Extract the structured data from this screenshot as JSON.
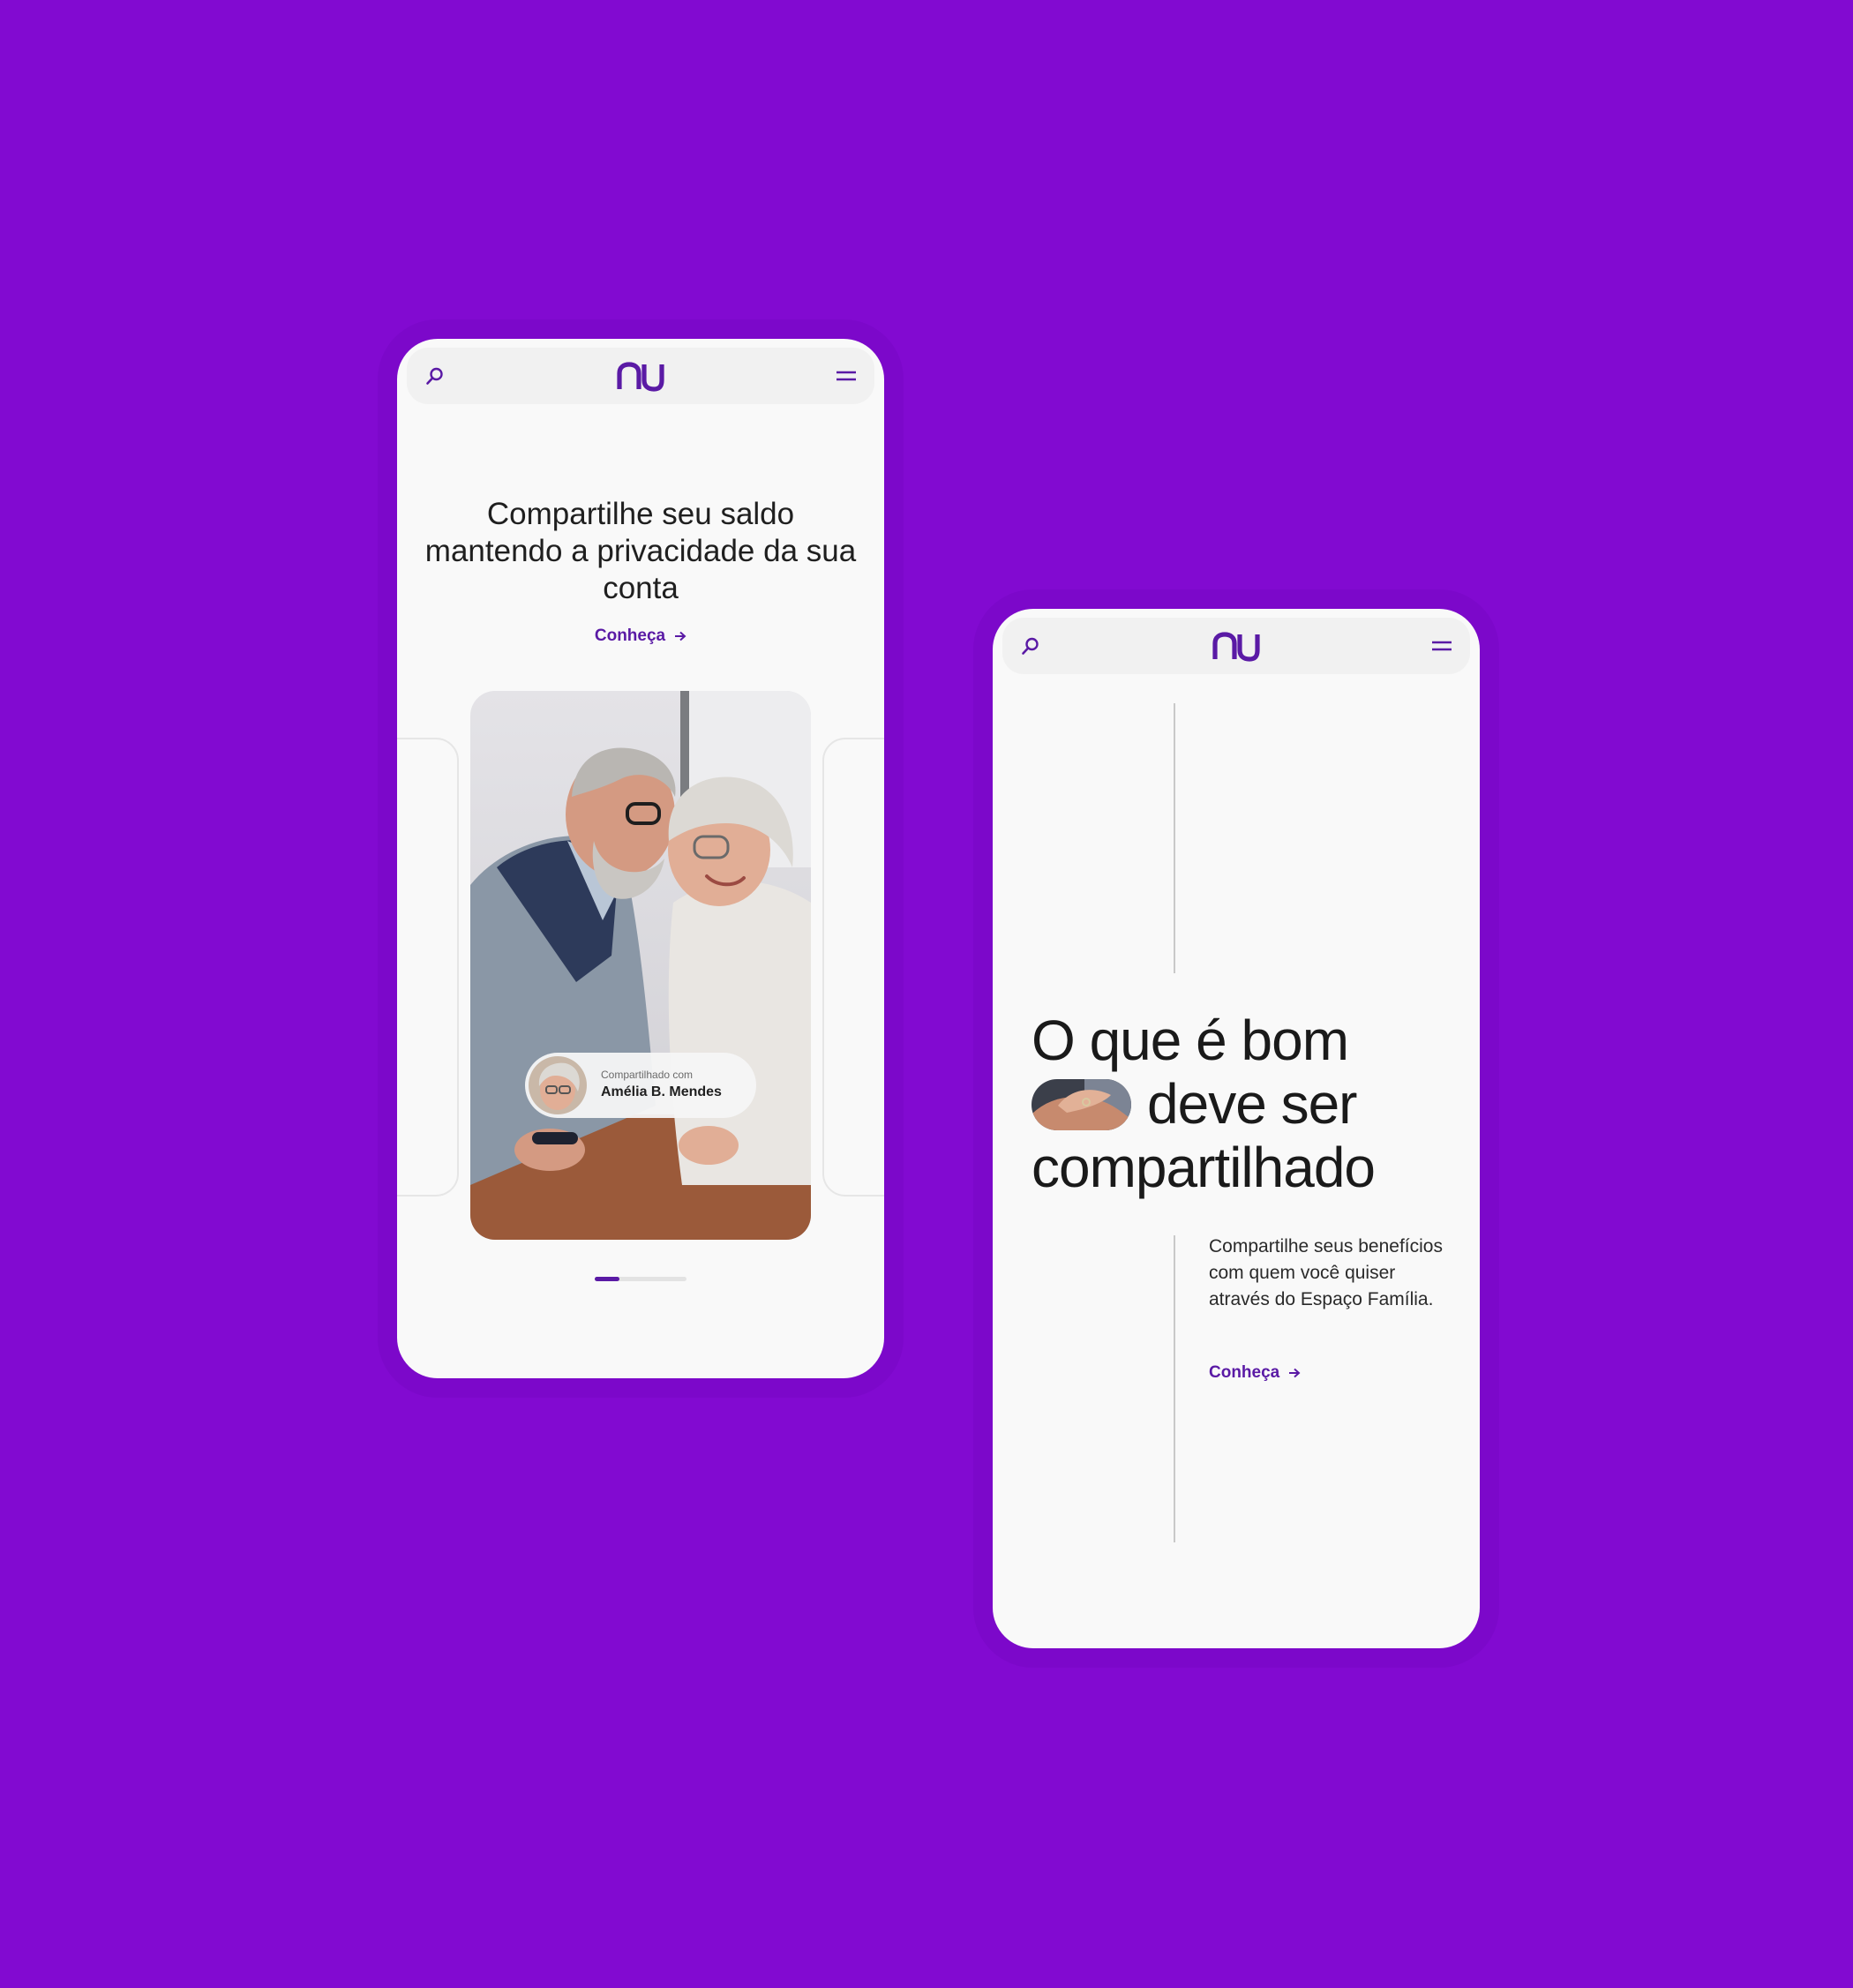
{
  "colors": {
    "background": "#820AD1",
    "brand": "#5A1AA5",
    "surface": "#F9F9F9",
    "nav_bg": "#F1F1F1"
  },
  "screen_a": {
    "logo_text": "nu",
    "icons": {
      "search": "search-icon",
      "menu": "hamburger-menu-icon",
      "link_arrow": "arrow-right-icon"
    },
    "headline": "Compartilhe seu saldo mantendo a privacidade da sua conta",
    "cta_label": "Conheça",
    "photo_alt": "Casal de idosos abraçados sorrindo",
    "shared_badge": {
      "caption": "Compartilhado com",
      "name": "Amélia B. Mendes"
    },
    "carousel": {
      "slide_count": 3,
      "active_index": 1
    }
  },
  "screen_b": {
    "logo_text": "nu",
    "icons": {
      "search": "search-icon",
      "menu": "hamburger-menu-icon",
      "link_arrow": "arrow-right-icon"
    },
    "headline_line1": "O que é bom",
    "headline_line2": "deve ser",
    "headline_line3": "compartilhado",
    "body": "Compartilhe seus benefícios com quem você quiser através do Espaço Família.",
    "cta_label": "Conheça"
  }
}
